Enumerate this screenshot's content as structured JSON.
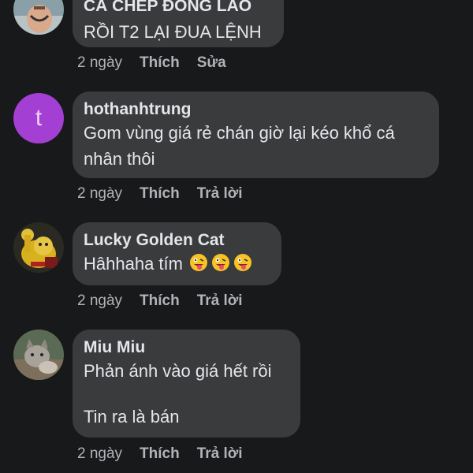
{
  "comments": [
    {
      "author": "CÁ CHÉP ĐÔNG LÀO",
      "text": "RỒI T2 LẠI ĐUA LỆNH",
      "time": "2 ngày",
      "like": "Thích",
      "action": "Sửa"
    },
    {
      "author": "hothanhtrung",
      "avatar_letter": "t",
      "avatar_color": "#a33fd3",
      "text": "Gom vùng giá rẻ chán giờ lại kéo khổ cá\nnhân thôi",
      "time": "2 ngày",
      "like": "Thích",
      "action": "Trả lời"
    },
    {
      "author": "Lucky Golden Cat",
      "text": "Hâhhaha tím",
      "emojis": [
        "zany-face-icon",
        "zany-face-icon",
        "zany-face-icon"
      ],
      "time": "2 ngày",
      "like": "Thích",
      "action": "Trả lời"
    },
    {
      "author": "Miu Miu",
      "text": "Phản ánh vào giá hết rồi\n\nTin ra là bán",
      "time": "2 ngày",
      "like": "Thích",
      "action": "Trả lời"
    }
  ],
  "colors": {
    "background": "#18191a",
    "bubble": "#3a3b3c",
    "primary_text": "#e4e6eb",
    "secondary_text": "#b0b3b8"
  }
}
